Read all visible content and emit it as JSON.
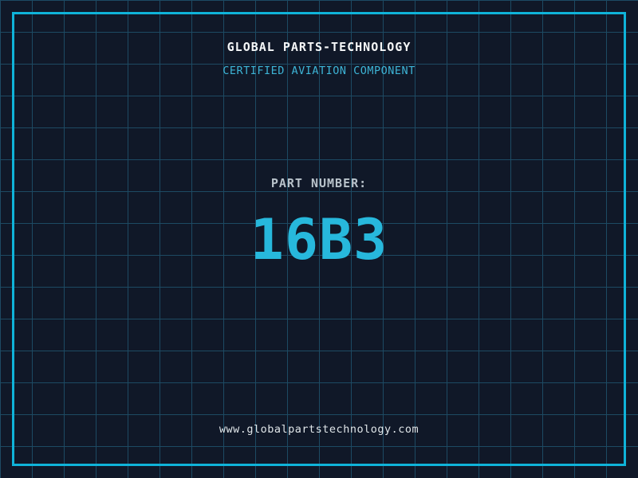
{
  "header": {
    "title": "GLOBAL PARTS-TECHNOLOGY",
    "subtitle": "CERTIFIED AVIATION COMPONENT"
  },
  "part": {
    "label": "PART NUMBER:",
    "number": "16B3"
  },
  "footer": {
    "website": "www.globalpartstechnology.com"
  },
  "colors": {
    "background": "#101828",
    "grid_line": "#1d4a63",
    "frame": "#0fb3d9",
    "title": "#f5f7f8",
    "subtitle": "#3db4d6",
    "label": "#b9c3cb",
    "number": "#27b8dc",
    "footer_text": "#dfe5e8"
  }
}
